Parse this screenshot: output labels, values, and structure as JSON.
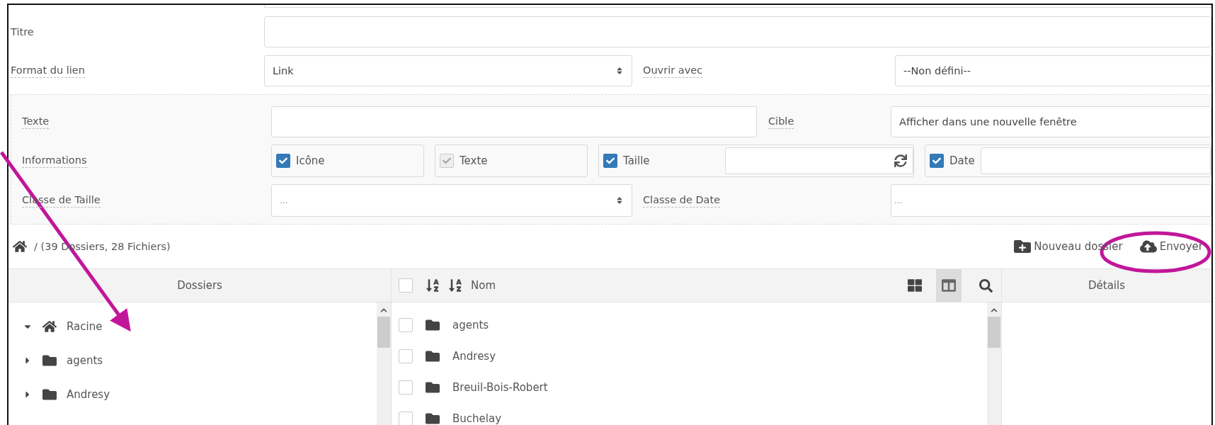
{
  "link_form": {
    "title": {
      "label": "Titre"
    },
    "link_format": {
      "label": "Format du lien",
      "value": "Link"
    },
    "open_with": {
      "label": "Ouvrir avec",
      "value": "--Non défini--"
    },
    "text": {
      "label": "Texte"
    },
    "target": {
      "label": "Cible",
      "value": "Afficher dans une nouvelle fenêtre"
    },
    "information": {
      "label": "Informations",
      "options": [
        {
          "label": "Icône",
          "checked": true,
          "disabled": false,
          "kind": "plain"
        },
        {
          "label": "Texte",
          "checked": true,
          "disabled": true,
          "kind": "plain"
        },
        {
          "label": "Taille",
          "checked": true,
          "disabled": false,
          "kind": "refresh"
        },
        {
          "label": "Date",
          "checked": true,
          "disabled": false,
          "kind": "field"
        }
      ]
    },
    "size_class": {
      "label": "Classe de Taille",
      "placeholder": "..."
    },
    "date_class": {
      "label": "Classe de Date",
      "placeholder": "..."
    }
  },
  "file_browser": {
    "breadcrumb": "/ (39 Dossiers, 28 Fichiers)",
    "actions": [
      {
        "label": "Nouveau dossier",
        "kind": "new_folder"
      },
      {
        "label": "Envoyer",
        "kind": "upload"
      }
    ],
    "folders": {
      "header": "Dossiers",
      "tree": [
        {
          "label": "Racine",
          "kind": "home",
          "expanded": true,
          "children": [
            {
              "label": "agents",
              "kind": "folder",
              "expanded": false
            },
            {
              "label": "Andresy",
              "kind": "folder",
              "expanded": false
            }
          ]
        }
      ]
    },
    "files": {
      "header": "Nom",
      "select_all": false,
      "views": [
        {
          "kind": "grid",
          "selected": false
        },
        {
          "kind": "columns",
          "selected": true
        }
      ],
      "rows": [
        {
          "name": "agents",
          "checked": false
        },
        {
          "name": "Andresy",
          "checked": false
        },
        {
          "name": "Breuil-Bois-Robert",
          "checked": false
        },
        {
          "name": "Buchelay",
          "checked": false
        }
      ]
    },
    "details": {
      "header": "Détails"
    }
  }
}
